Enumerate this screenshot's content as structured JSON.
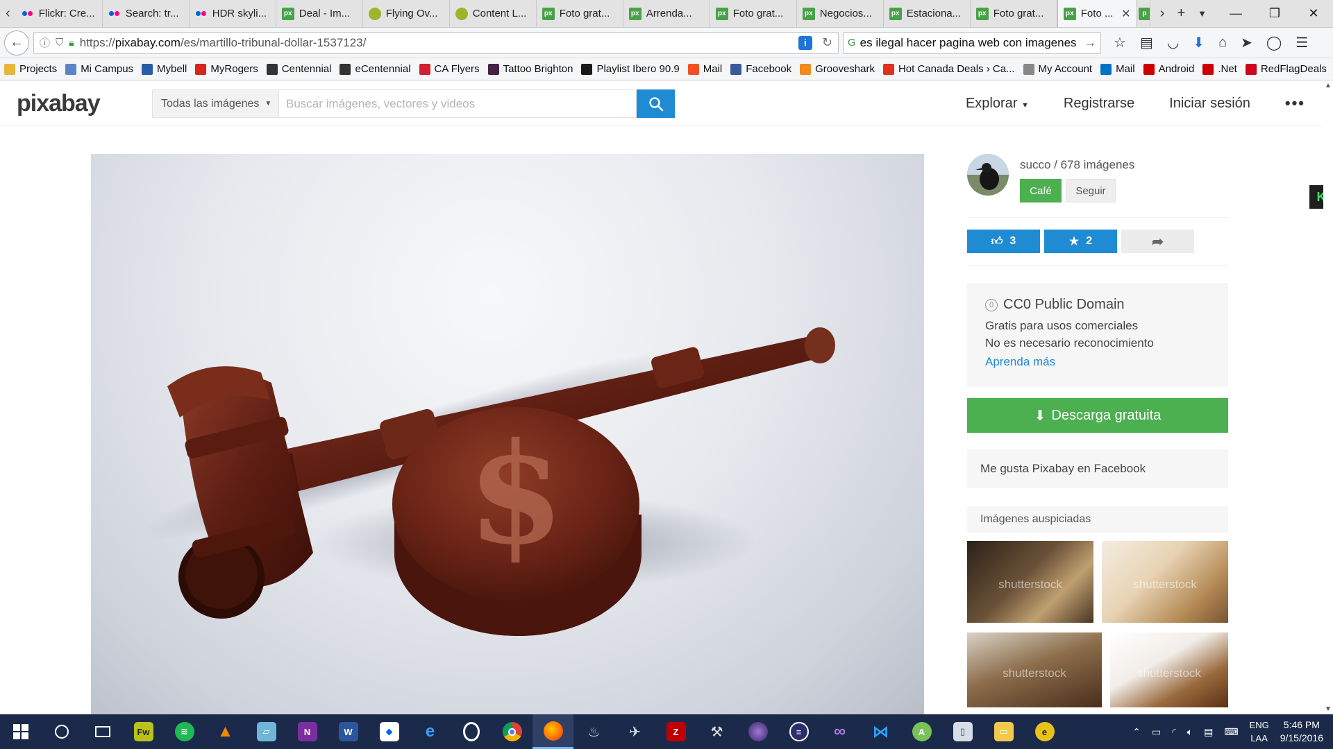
{
  "browser": {
    "tabs": [
      {
        "label": "Flickr: Cre...",
        "icon": "flickr"
      },
      {
        "label": "Search: tr...",
        "icon": "flickr"
      },
      {
        "label": "HDR skyli...",
        "icon": "flickr"
      },
      {
        "label": "Deal - Im...",
        "icon": "px"
      },
      {
        "label": "Flying Ov...",
        "icon": "fly"
      },
      {
        "label": "Content L...",
        "icon": "fly"
      },
      {
        "label": "Foto grat...",
        "icon": "px"
      },
      {
        "label": "Arrenda...",
        "icon": "px"
      },
      {
        "label": "Foto grat...",
        "icon": "px"
      },
      {
        "label": "Negocios...",
        "icon": "px"
      },
      {
        "label": "Estaciona...",
        "icon": "px"
      },
      {
        "label": "Foto grat...",
        "icon": "px"
      }
    ],
    "active_tab": {
      "label": "Foto ...",
      "close": "✕"
    },
    "url_prefix": "https://",
    "url_domain": "pixabay.com",
    "url_path": "/es/martillo-tribunal-dollar-1537123/",
    "search_query": "es ilegal hacer pagina web con imagenes",
    "bookmarks": [
      {
        "label": "Projects",
        "color": "#e6b73a"
      },
      {
        "label": "Mi Campus",
        "color": "#5a86c8"
      },
      {
        "label": "Mybell",
        "color": "#2a5caa"
      },
      {
        "label": "MyRogers",
        "color": "#d9261c"
      },
      {
        "label": "Centennial",
        "color": "#333333"
      },
      {
        "label": "eCentennial",
        "color": "#333333"
      },
      {
        "label": "CA Flyers",
        "color": "#d02030"
      },
      {
        "label": "Tattoo Brighton",
        "color": "#442244"
      },
      {
        "label": "Playlist Ibero 90.9",
        "color": "#1a1a1a"
      },
      {
        "label": "Mail",
        "color": "#f25022"
      },
      {
        "label": "Facebook",
        "color": "#3b5998"
      },
      {
        "label": "Grooveshark",
        "color": "#f28a1e"
      },
      {
        "label": "Hot Canada Deals › Ca...",
        "color": "#e0301e"
      },
      {
        "label": "My Account",
        "color": "#888888"
      },
      {
        "label": "Mail",
        "color": "#0072c6"
      },
      {
        "label": "Android",
        "color": "#cc0000"
      },
      {
        "label": ".Net",
        "color": "#cc0000"
      },
      {
        "label": "RedFlagDeals",
        "color": "#d0021b"
      }
    ],
    "bookmarks_overflow": "»"
  },
  "site": {
    "logo": "pixabay",
    "search_type": "Todas las imágenes",
    "search_placeholder": "Buscar imágenes, vectores y videos",
    "nav": {
      "explore": "Explorar",
      "register": "Registrarse",
      "login": "Iniciar sesión",
      "more": "•••"
    }
  },
  "image": {
    "alt": "martillo tribunal dollar"
  },
  "author": {
    "name_line": "succo / 678 imágenes",
    "cafe_label": "Café",
    "follow_label": "Seguir"
  },
  "stats": {
    "likes": "3",
    "favorites": "2"
  },
  "license": {
    "title": "CC0 Public Domain",
    "line1": "Gratis para usos comerciales",
    "line2": "No es necesario reconocimiento",
    "link": "Aprenda más"
  },
  "download_label": "Descarga gratuita",
  "facebook_box": "Me gusta Pixabay en Facebook",
  "sponsored": {
    "title": "Imágenes auspiciadas",
    "watermark": "shutterstock"
  },
  "kbadge": "K",
  "taskbar": {
    "lang1": "ENG",
    "lang2": "LAA",
    "time": "5:46 PM",
    "date": "9/15/2016"
  }
}
